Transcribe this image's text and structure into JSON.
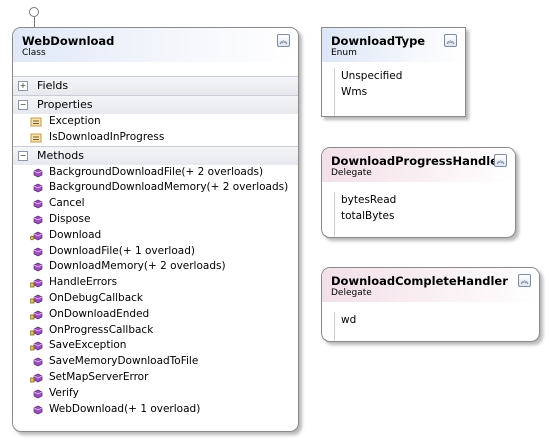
{
  "web_download": {
    "name": "WebDownload",
    "kind": "Class",
    "sections": {
      "fields": "Fields",
      "properties": "Properties",
      "methods": "Methods"
    },
    "properties": [
      "Exception",
      "IsDownloadInProgress"
    ],
    "methods": [
      {
        "label": "BackgroundDownloadFile(+ 2 overloads)",
        "icon": "public-method-icon"
      },
      {
        "label": "BackgroundDownloadMemory(+ 2 overloads)",
        "icon": "public-method-icon"
      },
      {
        "label": "Cancel",
        "icon": "public-method-icon"
      },
      {
        "label": "Dispose",
        "icon": "public-method-icon"
      },
      {
        "label": "Download",
        "icon": "key-method-icon"
      },
      {
        "label": "DownloadFile(+ 1 overload)",
        "icon": "public-method-icon"
      },
      {
        "label": "DownloadMemory(+ 2 overloads)",
        "icon": "public-method-icon"
      },
      {
        "label": "HandleErrors",
        "icon": "private-method-icon"
      },
      {
        "label": "OnDebugCallback",
        "icon": "private-method-icon"
      },
      {
        "label": "OnDownloadEnded",
        "icon": "private-method-icon"
      },
      {
        "label": "OnProgressCallback",
        "icon": "private-method-icon"
      },
      {
        "label": "SaveException",
        "icon": "private-method-icon"
      },
      {
        "label": "SaveMemoryDownloadToFile",
        "icon": "public-method-icon"
      },
      {
        "label": "SetMapServerError",
        "icon": "private-method-icon"
      },
      {
        "label": "Verify",
        "icon": "public-method-icon"
      },
      {
        "label": "WebDownload(+ 1 overload)",
        "icon": "public-method-icon"
      }
    ]
  },
  "download_type": {
    "name": "DownloadType",
    "kind": "Enum",
    "values": [
      "Unspecified",
      "Wms"
    ]
  },
  "download_progress_handler": {
    "name": "DownloadProgressHandler",
    "kind": "Delegate",
    "params": [
      "bytesRead",
      "totalBytes"
    ]
  },
  "download_complete_handler": {
    "name": "DownloadCompleteHandler",
    "kind": "Delegate",
    "params": [
      "wd"
    ]
  },
  "colors": {
    "header_gradient_start": "#e0e8f8",
    "method_icon": "#9b4fb8",
    "property_icon": "#c89a3c",
    "border": "#8a8a8a"
  }
}
